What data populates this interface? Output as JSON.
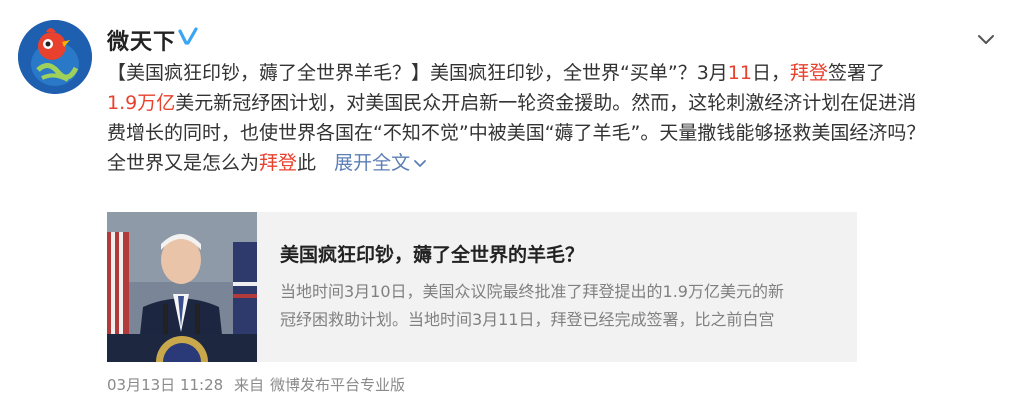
{
  "account": {
    "name": "微天下",
    "verified_icon": "verified-v-icon",
    "menu_icon": "chevron-down-icon"
  },
  "post": {
    "line1": {
      "a": "【美国疯狂印钞，薅了全世界羊毛？】美国疯狂印钞，全世界“买单”？3月",
      "b": "11",
      "c": "日，",
      "d": "拜登",
      "e": "签署了"
    },
    "line2": {
      "a": "1.9万亿",
      "b": "美元新冠纾困计划，对美国民众开启新一轮资金援助。然而，这轮刺激经济计划在促进消"
    },
    "line3": "费增长的同时，也使世界各国在“不知不觉”中被美国“薅了羊毛”。天量撒钱能够拯救美国经济吗？",
    "line4": {
      "a": "全世界又是怎么为",
      "b": "拜登",
      "c": "此"
    },
    "expand_label": "展开全文"
  },
  "card": {
    "title": "美国疯狂印钞，薅了全世界的羊毛？",
    "desc_line1": "当地时间3月10日，美国众议院最终批准了拜登提出的1.9万亿美元的新",
    "desc_line2": "冠纾困救助计划。当地时间3月11日，拜登已经完成签署，比之前白宫"
  },
  "meta": {
    "time": "03月13日 11:28",
    "source_prefix": "来自",
    "source": "微博发布平台专业版"
  },
  "colors": {
    "highlight": "#e8412e",
    "link": "#5b7fb6",
    "verified": "#3aa6f2"
  }
}
